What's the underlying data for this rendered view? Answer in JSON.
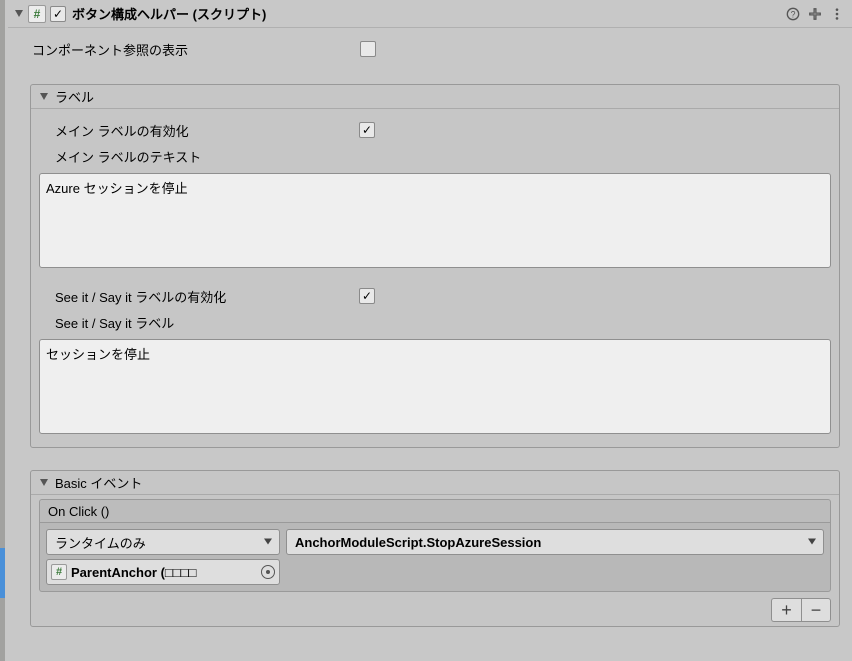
{
  "header": {
    "title": "ボタン構成ヘルパー (スクリプト)",
    "enabled": true
  },
  "props": {
    "show_component_refs_label": "コンポーネント参照の表示",
    "show_component_refs_value": false
  },
  "labels_section": {
    "title": "ラベル",
    "main_label_enable_label": "メイン ラベルの有効化",
    "main_label_enable_value": true,
    "main_label_text_label": "メイン ラベルのテキスト",
    "main_label_text_value": "Azure セッションを停止",
    "see_say_enable_label": "See it / Say it ラベルの有効化",
    "see_say_enable_value": true,
    "see_say_text_label": "See it / Say it ラベル",
    "see_say_text_value": "セッションを停止"
  },
  "events_section": {
    "title": "Basic イベント",
    "onclick_title": "On Click ()",
    "runtime_mode": "ランタイムのみ",
    "function": "AnchorModuleScript.StopAzureSession",
    "target_object": "ParentAnchor (□□□□"
  },
  "icons": {
    "hash": "#",
    "check": "✓",
    "plus": "+",
    "minus": "−"
  }
}
